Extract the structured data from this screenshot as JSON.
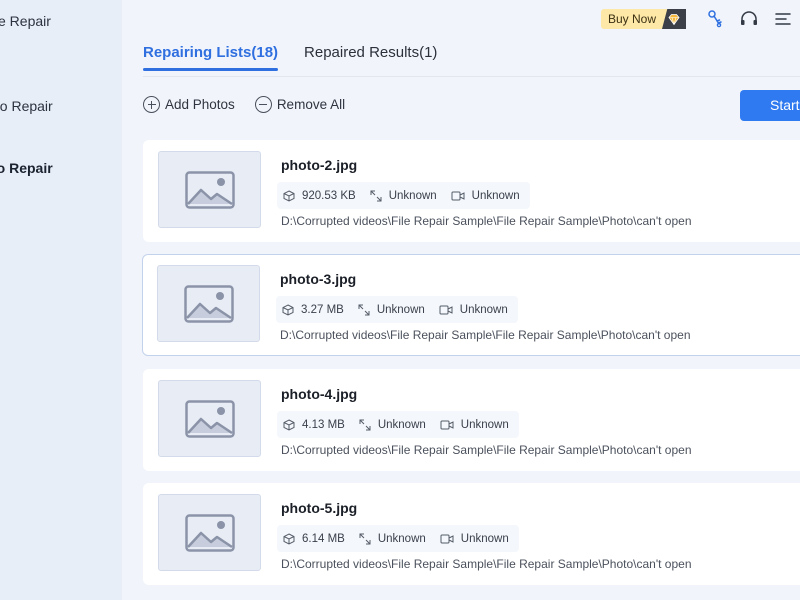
{
  "sidebar": {
    "items": [
      {
        "label": "e Repair"
      },
      {
        "label": "eo Repair"
      },
      {
        "label": "to Repair"
      }
    ]
  },
  "topbar": {
    "buy_now": "Buy Now",
    "icons": [
      "diamond-icon",
      "key-icon",
      "headset-icon",
      "menu-icon"
    ]
  },
  "tabs": [
    {
      "label": "Repairing Lists(18)",
      "active": true
    },
    {
      "label": "Repaired Results(1)",
      "active": false
    }
  ],
  "actions": {
    "add_photos": "Add Photos",
    "remove_all": "Remove All",
    "start": "Start"
  },
  "files": [
    {
      "name": "photo-2.jpg",
      "size": "920.53 KB",
      "resolution": "Unknown",
      "device": "Unknown",
      "path": "D:\\Corrupted videos\\File Repair Sample\\File Repair Sample\\Photo\\can't open"
    },
    {
      "name": "photo-3.jpg",
      "size": "3.27 MB",
      "resolution": "Unknown",
      "device": "Unknown",
      "path": "D:\\Corrupted videos\\File Repair Sample\\File Repair Sample\\Photo\\can't open"
    },
    {
      "name": "photo-4.jpg",
      "size": "4.13 MB",
      "resolution": "Unknown",
      "device": "Unknown",
      "path": "D:\\Corrupted videos\\File Repair Sample\\File Repair Sample\\Photo\\can't open"
    },
    {
      "name": "photo-5.jpg",
      "size": "6.14 MB",
      "resolution": "Unknown",
      "device": "Unknown",
      "path": "D:\\Corrupted videos\\File Repair Sample\\File Repair Sample\\Photo\\can't open"
    }
  ],
  "colors": {
    "accent": "#2f7af0",
    "tab_active": "#2f6fe0",
    "buy_now_bg": "#fde8a7"
  }
}
